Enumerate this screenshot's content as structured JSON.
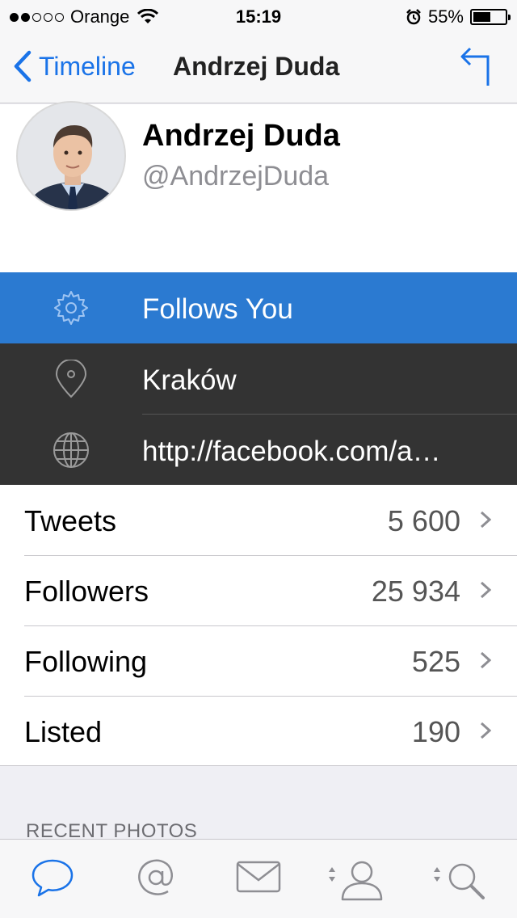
{
  "status_bar": {
    "carrier": "Orange",
    "time": "15:19",
    "battery": "55%",
    "battery_level": 0.55
  },
  "nav": {
    "back_label": "Timeline",
    "title": "Andrzej Duda"
  },
  "profile": {
    "name": "Andrzej Duda",
    "handle": "@AndrzejDuda"
  },
  "info": {
    "follows": "Follows You",
    "location": "Kraków",
    "url": "http://facebook.com/a…"
  },
  "stats": [
    {
      "label": "Tweets",
      "value": "5 600"
    },
    {
      "label": "Followers",
      "value": "25 934"
    },
    {
      "label": "Following",
      "value": "525"
    },
    {
      "label": "Listed",
      "value": "190"
    }
  ],
  "section": {
    "recent_photos": "RECENT PHOTOS"
  },
  "tabs": [
    "timeline-icon",
    "mentions-icon",
    "messages-icon",
    "profile-icon",
    "search-icon"
  ],
  "colors": {
    "accent": "#1a73e8",
    "follows_bg": "#2b7ad1",
    "dark_row_bg": "#333333",
    "icon_gray": "#8e8e93"
  }
}
